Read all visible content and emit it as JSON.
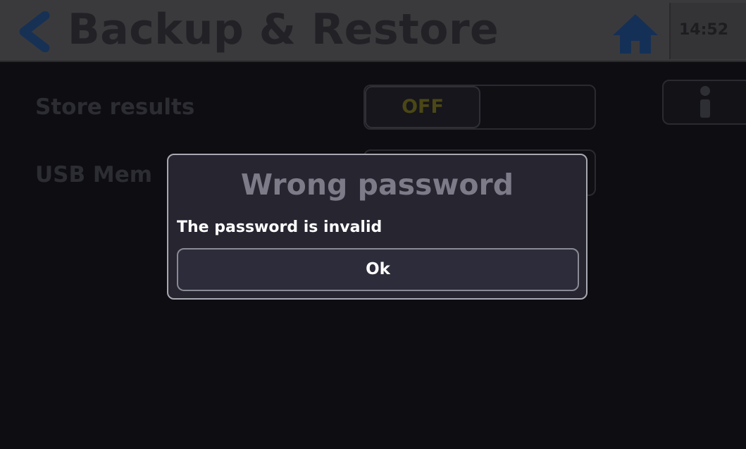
{
  "header": {
    "title": "Backup & Restore",
    "time": "14:52",
    "back_icon": "chevron-left-icon",
    "home_icon": "home-icon"
  },
  "settings": {
    "store_results_label": "Store results",
    "store_results_value": "OFF",
    "usb_memory_label": "USB Mem",
    "info_icon": "info-icon"
  },
  "dialog": {
    "title": "Wrong password",
    "message": "The password is invalid",
    "ok_label": "Ok"
  },
  "colors": {
    "accent_blue": "#1b3a66",
    "toggle_off_text": "#4b4716",
    "dialog_bg": "#262530",
    "dialog_border": "#a9a9b3"
  }
}
